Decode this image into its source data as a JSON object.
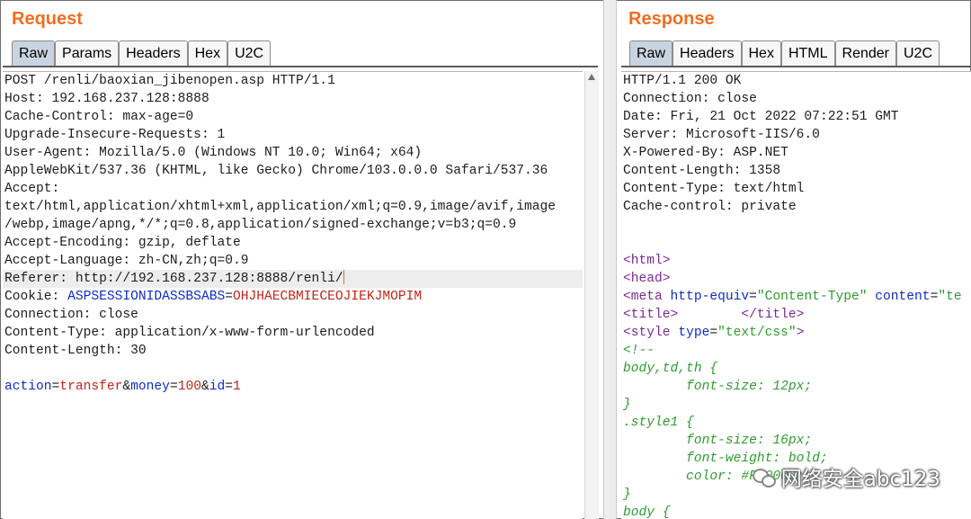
{
  "request": {
    "title": "Request",
    "tabs": [
      "Raw",
      "Params",
      "Headers",
      "Hex",
      "U2C"
    ],
    "active_tab": "Raw",
    "lines": [
      [
        {
          "t": "POST /renli/baoxian_jibenopen.asp HTTP/1.1"
        }
      ],
      [
        {
          "t": "Host: 192.168.237.128:8888"
        }
      ],
      [
        {
          "t": "Cache-Control: max-age=0"
        }
      ],
      [
        {
          "t": "Upgrade-Insecure-Requests: 1"
        }
      ],
      [
        {
          "t": "User-Agent: Mozilla/5.0 (Windows NT 10.0; Win64; x64)"
        }
      ],
      [
        {
          "t": "AppleWebKit/537.36 (KHTML, like Gecko) Chrome/103.0.0.0 Safari/537.36"
        }
      ],
      [
        {
          "t": "Accept:"
        }
      ],
      [
        {
          "t": "text/html,application/xhtml+xml,application/xml;q=0.9,image/avif,image"
        }
      ],
      [
        {
          "t": "/webp,image/apng,*/*;q=0.8,application/signed-exchange;v=b3;q=0.9"
        }
      ],
      [
        {
          "t": "Accept-Encoding: gzip, deflate"
        }
      ],
      [
        {
          "t": "Accept-Language: zh-CN,zh;q=0.9"
        }
      ],
      [
        {
          "t": "Referer: http://192.168.237.128:8888/renli/"
        }
      ],
      [
        {
          "t": "Cookie: "
        },
        {
          "t": "ASPSESSIONIDASSBSABS",
          "c": "k"
        },
        {
          "t": "="
        },
        {
          "t": "OHJHAECBMIECEOJIEKJMOPIM",
          "c": "v"
        }
      ],
      [
        {
          "t": "Connection: close"
        }
      ],
      [
        {
          "t": "Content-Type: application/x-www-form-urlencoded"
        }
      ],
      [
        {
          "t": "Content-Length: 30"
        }
      ],
      [
        {
          "t": ""
        }
      ],
      [
        {
          "t": "action",
          "c": "k"
        },
        {
          "t": "="
        },
        {
          "t": "transfer",
          "c": "v"
        },
        {
          "t": "&"
        },
        {
          "t": "money",
          "c": "k"
        },
        {
          "t": "="
        },
        {
          "t": "100",
          "c": "v"
        },
        {
          "t": "&"
        },
        {
          "t": "id",
          "c": "k"
        },
        {
          "t": "="
        },
        {
          "t": "1",
          "c": "v"
        }
      ]
    ]
  },
  "response": {
    "title": "Response",
    "tabs": [
      "Raw",
      "Headers",
      "Hex",
      "HTML",
      "Render",
      "U2C"
    ],
    "active_tab": "Raw",
    "lines": [
      [
        {
          "t": "HTTP/1.1 200 OK"
        }
      ],
      [
        {
          "t": "Connection: close"
        }
      ],
      [
        {
          "t": "Date: Fri, 21 Oct 2022 07:22:51 GMT"
        }
      ],
      [
        {
          "t": "Server: Microsoft-IIS/6.0"
        }
      ],
      [
        {
          "t": "X-Powered-By: ASP.NET"
        }
      ],
      [
        {
          "t": "Content-Length: 1358"
        }
      ],
      [
        {
          "t": "Content-Type: text/html"
        }
      ],
      [
        {
          "t": "Cache-control: private"
        }
      ],
      [
        {
          "t": ""
        }
      ],
      [
        {
          "t": ""
        }
      ],
      [
        {
          "t": "<html>",
          "c": "tag"
        }
      ],
      [
        {
          "t": "<head>",
          "c": "tag"
        }
      ],
      [
        {
          "t": "<meta ",
          "c": "tag"
        },
        {
          "t": "http-equiv",
          "c": "attr"
        },
        {
          "t": "="
        },
        {
          "t": "\"Content-Type\"",
          "c": "str"
        },
        {
          "t": " "
        },
        {
          "t": "content",
          "c": "attr"
        },
        {
          "t": "="
        },
        {
          "t": "\"te",
          "c": "str"
        }
      ],
      [
        {
          "t": "<title>",
          "c": "tag"
        },
        {
          "t": "        "
        },
        {
          "t": "</title>",
          "c": "tag"
        }
      ],
      [
        {
          "t": "<style ",
          "c": "tag"
        },
        {
          "t": "type",
          "c": "attr"
        },
        {
          "t": "="
        },
        {
          "t": "\"text/css\"",
          "c": "str"
        },
        {
          "t": ">",
          "c": "tag"
        }
      ],
      [
        {
          "t": "<!--",
          "c": "css"
        }
      ],
      [
        {
          "t": "body,td,th {",
          "c": "css"
        }
      ],
      [
        {
          "t": "        font-size: 12px;",
          "c": "css"
        }
      ],
      [
        {
          "t": "}",
          "c": "css"
        }
      ],
      [
        {
          "t": ".style1 {",
          "c": "css"
        }
      ],
      [
        {
          "t": "        font-size: 16px;",
          "c": "css"
        }
      ],
      [
        {
          "t": "        font-weight: bold;",
          "c": "css"
        }
      ],
      [
        {
          "t": "        color: #FF0000;",
          "c": "css"
        }
      ],
      [
        {
          "t": "}",
          "c": "css"
        }
      ],
      [
        {
          "t": "body {",
          "c": "css"
        }
      ]
    ]
  },
  "watermark": "网络安全abc123"
}
